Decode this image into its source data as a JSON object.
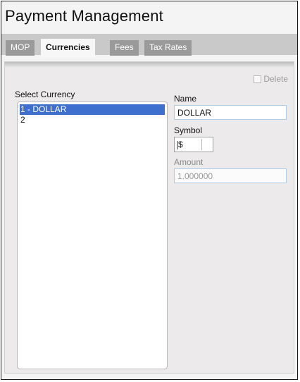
{
  "window": {
    "title": "Payment Management"
  },
  "tabs": [
    {
      "label": "MOP",
      "active": false
    },
    {
      "label": "Currencies",
      "active": true
    },
    {
      "label": "Fees",
      "active": false
    },
    {
      "label": "Tax Rates",
      "active": false
    }
  ],
  "panel": {
    "delete_label": "Delete",
    "select_currency_label": "Select Currency",
    "currencies": [
      {
        "label": "1 - DOLLAR",
        "selected": true
      },
      {
        "label": "2",
        "selected": false
      }
    ],
    "name": {
      "label": "Name",
      "value": "DOLLAR"
    },
    "symbol": {
      "label": "Symbol",
      "value": "$"
    },
    "amount": {
      "label": "Amount",
      "value": "1.000000"
    }
  },
  "colors": {
    "tab_inactive": "#9a9a9a",
    "tab_active": "#f7f7f7",
    "selection": "#3e6fce",
    "input_border": "#aecbe6"
  }
}
